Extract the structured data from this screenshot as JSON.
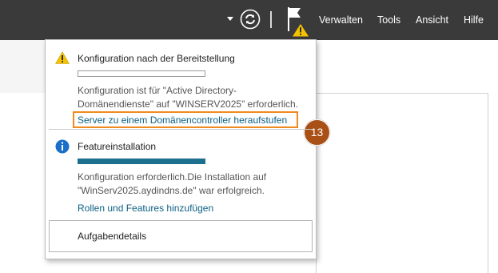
{
  "toolbar": {
    "manage": "Verwalten",
    "tools": "Tools",
    "view": "Ansicht",
    "help": "Hilfe"
  },
  "notifications": {
    "config": {
      "title": "Konfiguration nach der Bereitstellung",
      "progress": 0,
      "description_line1": "Konfiguration ist für \"Active Directory-",
      "description_line2": "Domänendienste\" auf \"WINSERV2025\" erforderlich.",
      "link": "Server zu einem Domänencontroller heraufstufen",
      "step_badge": "13"
    },
    "feature": {
      "title": "Featureinstallation",
      "progress": 1,
      "description_line1": "Konfiguration erforderlich.Die Installation auf",
      "description_line2": "\"WinServ2025.aydindns.de\" war erfolgreich.",
      "link": "Rollen und Features hinzufügen"
    },
    "task_details": "Aufgabendetails"
  },
  "colors": {
    "toolbar_bg": "#3a3a3a",
    "link": "#0c5f84",
    "highlight": "#ef8a1e",
    "badge": "#a95016",
    "progress": "#1d6f8e",
    "warning": "#f3c300",
    "info": "#1a6fc8"
  }
}
